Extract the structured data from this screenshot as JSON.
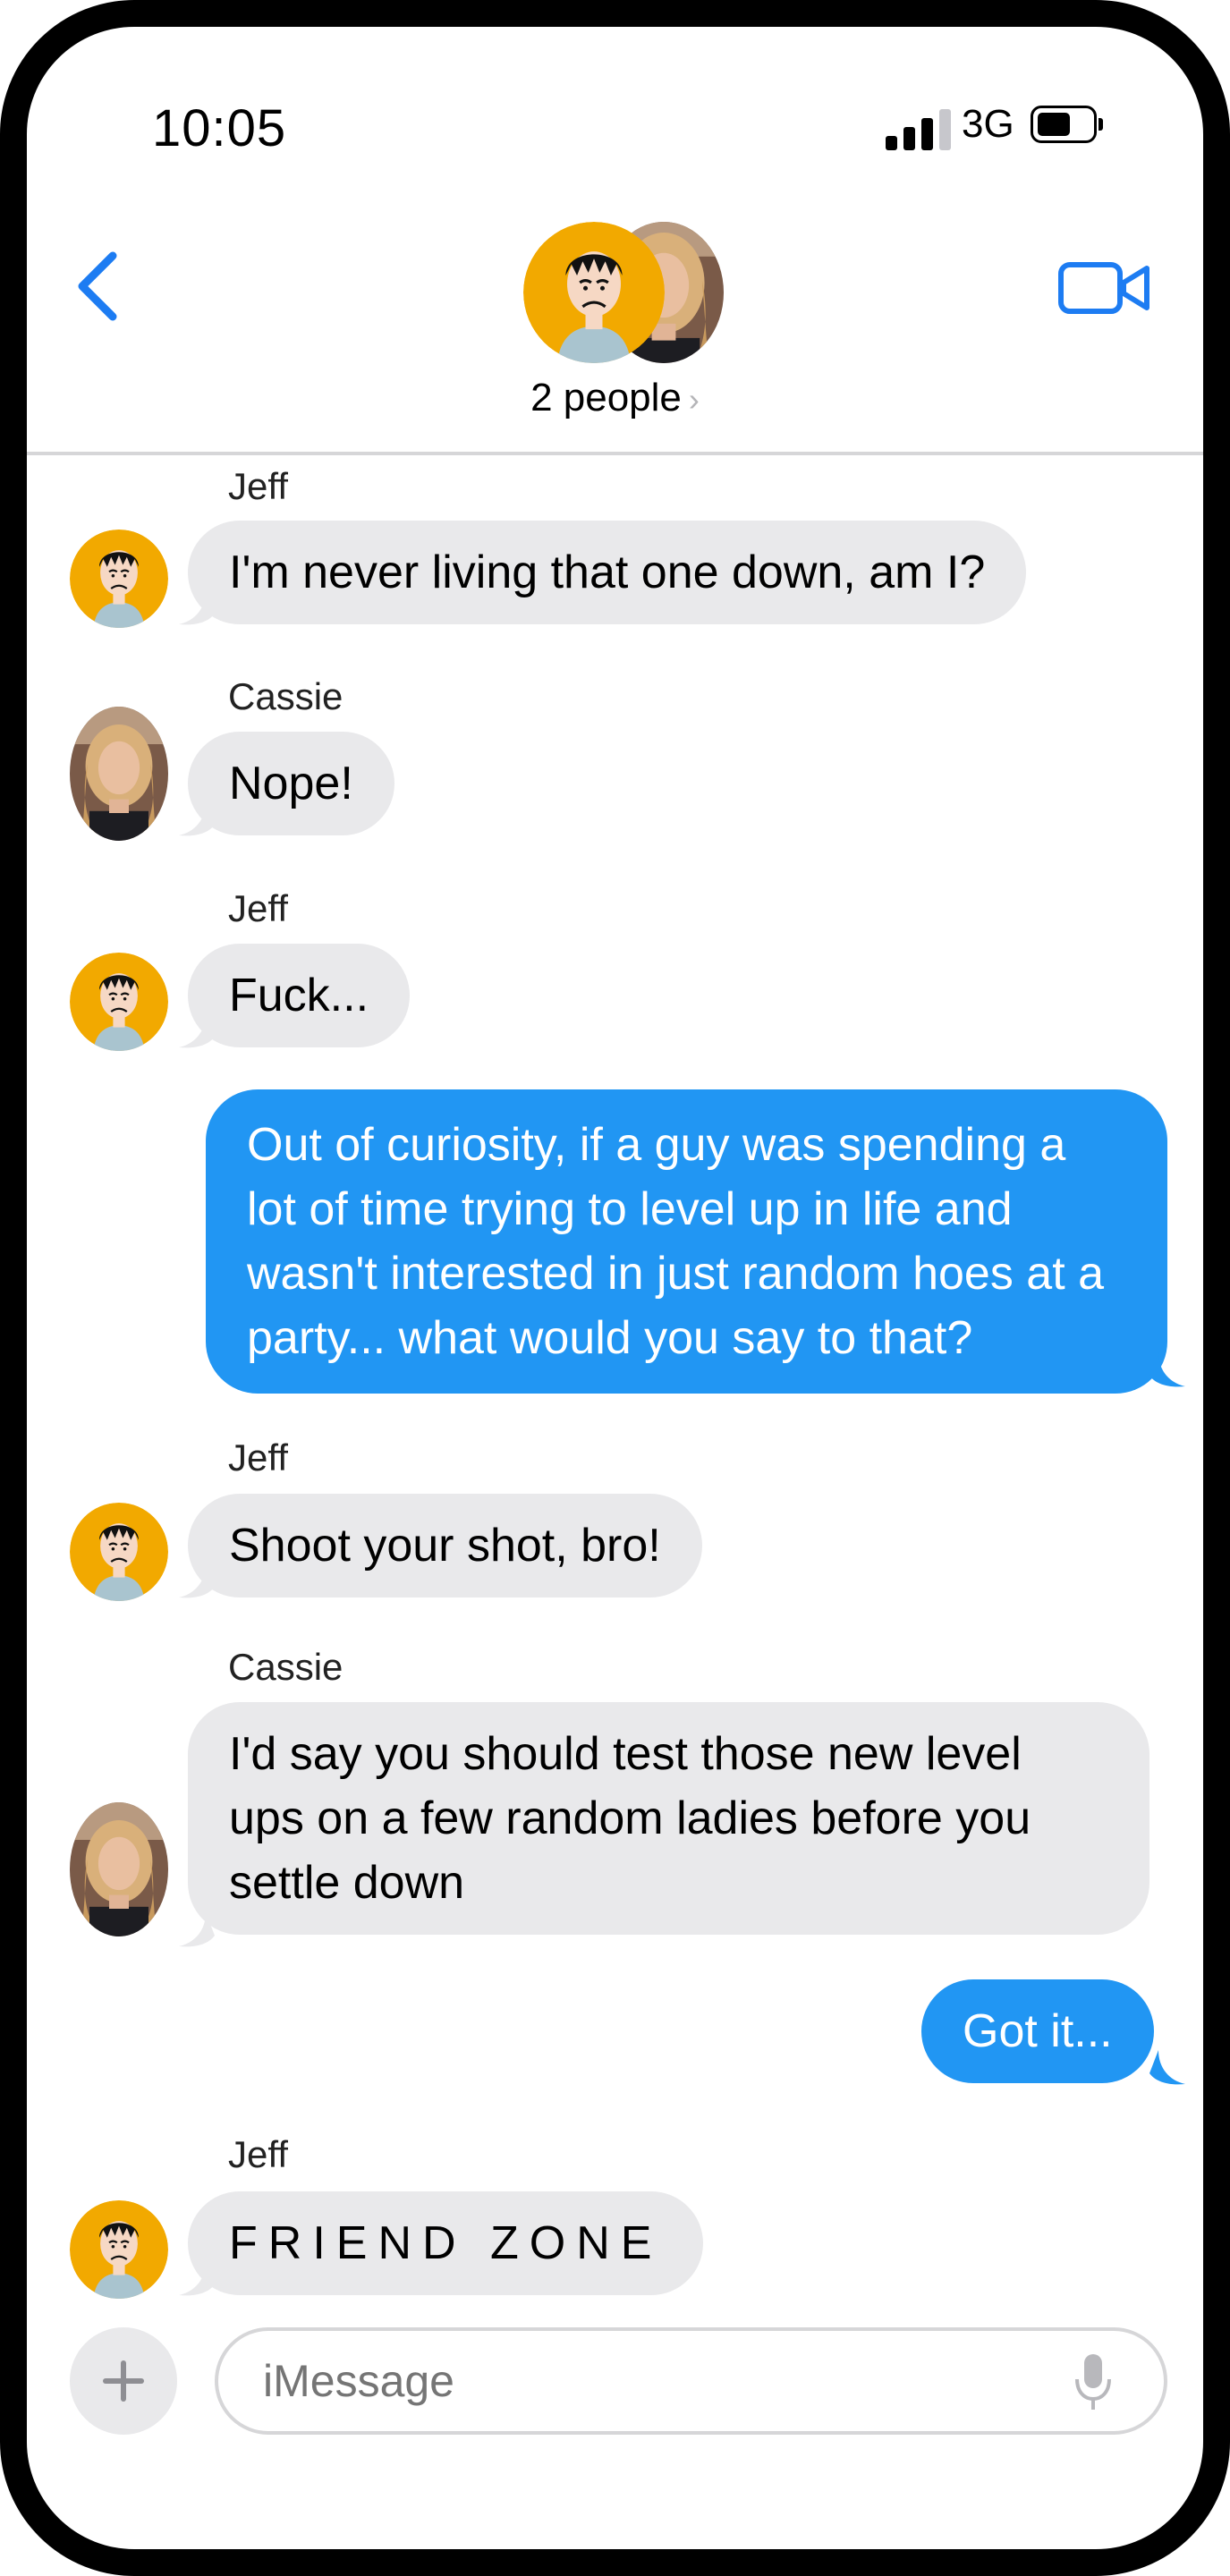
{
  "status_bar": {
    "time": "10:05",
    "network": "3G"
  },
  "nav": {
    "subtitle": "2 people",
    "chevron": "›"
  },
  "messages": [
    {
      "from": "Jeff",
      "side": "in",
      "text": "I'm never living that one down, am I?"
    },
    {
      "from": "Cassie",
      "side": "in",
      "text": "Nope!"
    },
    {
      "from": "Jeff",
      "side": "in",
      "text": "Fuck..."
    },
    {
      "from": "me",
      "side": "out",
      "text": "Out of curiosity, if a guy was spending a lot of time trying to level up in life and wasn't interested in just random hoes at a party... what would you say to that?"
    },
    {
      "from": "Jeff",
      "side": "in",
      "text": "Shoot your shot, bro!"
    },
    {
      "from": "Cassie",
      "side": "in",
      "text": "I'd say you should test those new level ups on a few random ladies before you settle down"
    },
    {
      "from": "me",
      "side": "out",
      "text": "Got it..."
    },
    {
      "from": "Jeff",
      "side": "in",
      "text": "FRIEND ZONE"
    }
  ],
  "composer": {
    "placeholder": "iMessage"
  },
  "colors": {
    "accent": "#2196f3",
    "incoming_bubble": "#e9e9eb",
    "avatar_bg": "#f2a900",
    "ios_blue": "#1d7cf2"
  },
  "icons": [
    "back-chevron-icon",
    "video-call-icon",
    "plus-icon",
    "microphone-icon",
    "cellular-signal-icon",
    "battery-icon"
  ]
}
